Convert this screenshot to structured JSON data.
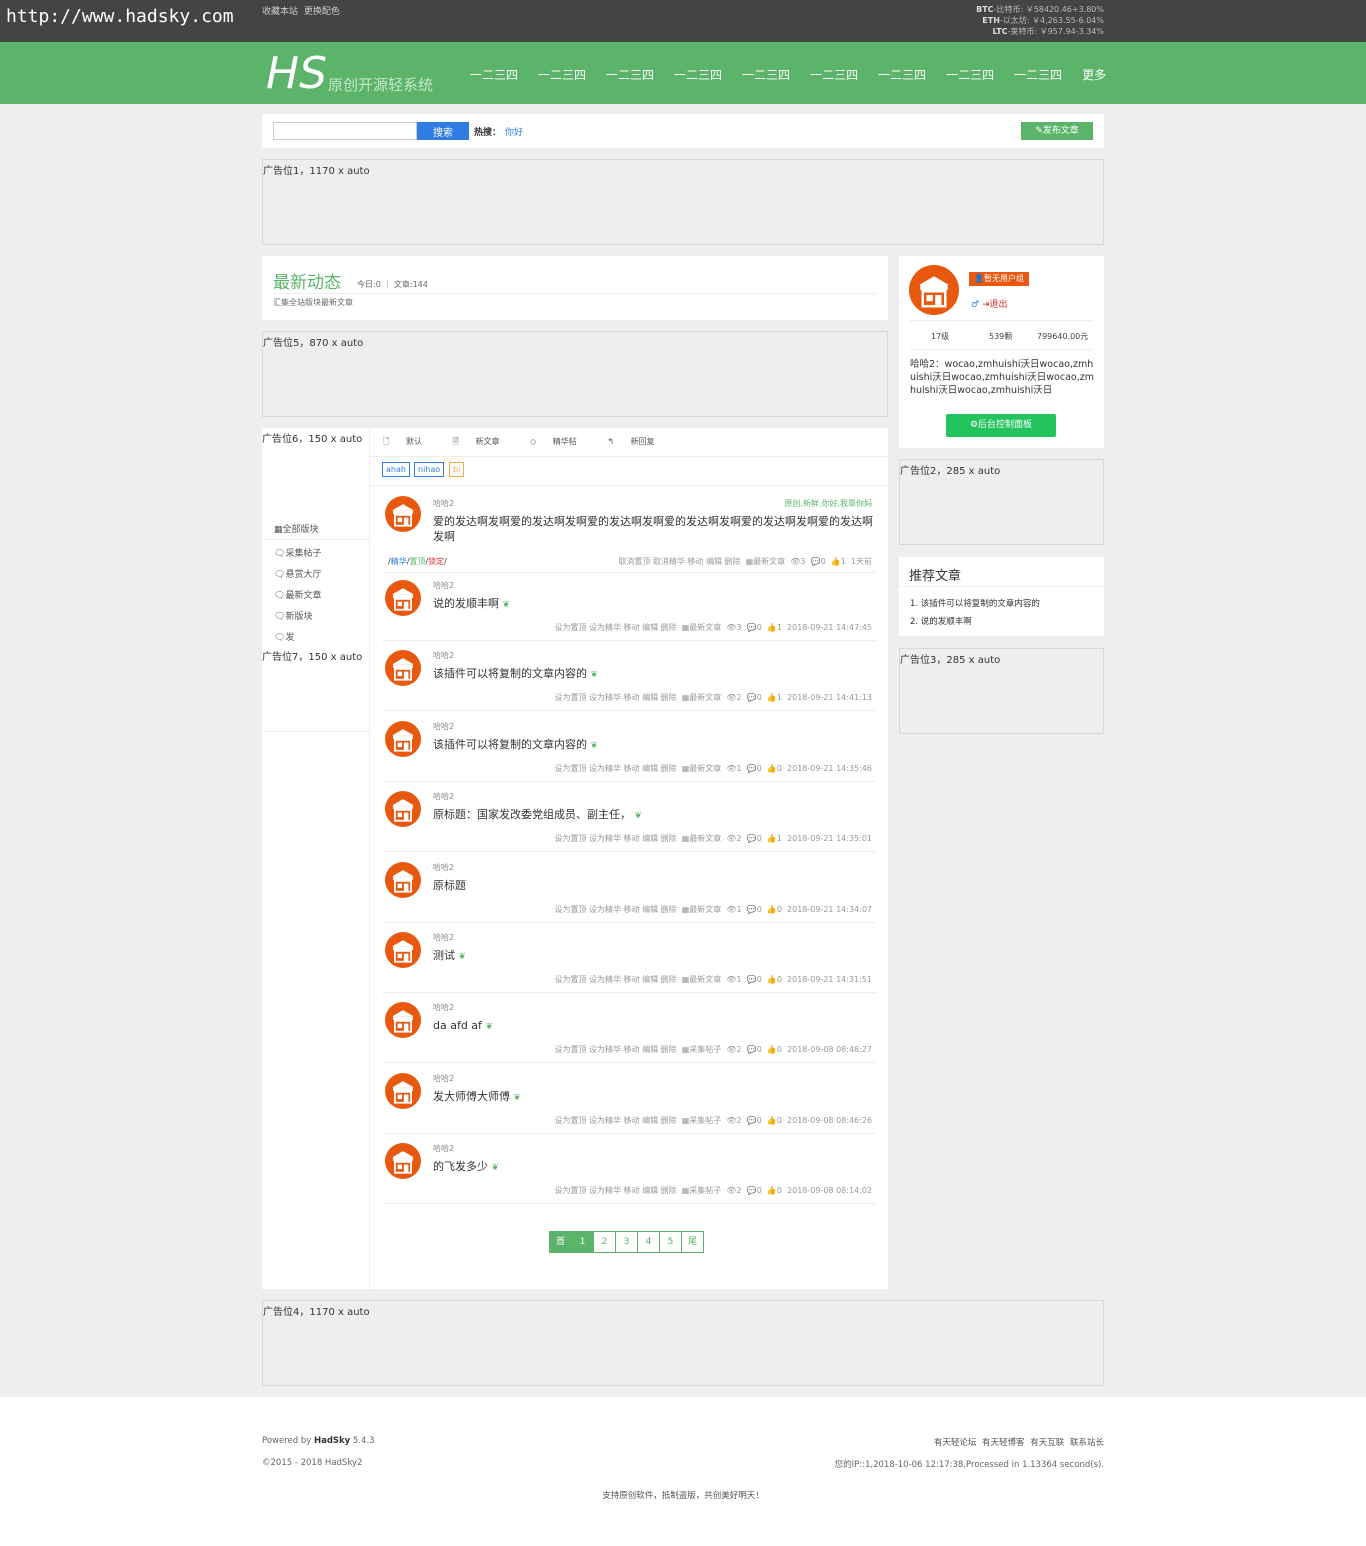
{
  "topbar": {
    "site_url": "http://www.hadsky.com",
    "links": [
      "收藏本站",
      "更换配色"
    ],
    "crypto": [
      {
        "code": "BTC",
        "name": "-比特币:",
        "value": "￥58420.46+3.80%"
      },
      {
        "code": "ETH",
        "name": "-以太坊:",
        "value": "￥4,263.55-6.04%"
      },
      {
        "code": "LTC",
        "name": "-莱特币:",
        "value": "￥957.94-3.34%"
      }
    ]
  },
  "header": {
    "logo": "HS",
    "logo_sub": "原创开源轻系统",
    "nav": [
      "一二三四",
      "一二三四",
      "一二三四",
      "一二三四",
      "一二三四",
      "一二三四",
      "一二三四",
      "一二三四",
      "一二三四",
      "更多"
    ],
    "accent": "#5bb46a"
  },
  "search": {
    "button": "搜索",
    "hot_label": "热搜：",
    "hot_link": "你好",
    "publish": "发布文章"
  },
  "ads": {
    "ad1": "广告位1，1170 x auto",
    "ad5": "广告位5，870 x auto",
    "ad6": "广告位6，150 x auto",
    "ad7": "广告位7，150 x auto",
    "ad2": "广告位2，285 x auto",
    "ad3": "广告位3，285 x auto",
    "ad4": "广告位4，1170 x auto"
  },
  "latest": {
    "title": "最新动态",
    "stats": "今日:0 ｜ 文章:144",
    "desc": "汇集全站版块最新文章"
  },
  "categories": {
    "all": "全部版块",
    "items": [
      "采集帖子",
      "悬赏大厅",
      "最新文章",
      "新版块",
      "发"
    ]
  },
  "feed": {
    "tabs": [
      "默认",
      "新文章",
      "精华帖",
      "新回复"
    ],
    "tags": [
      "ahah",
      "nihao",
      "bi"
    ],
    "first_post_tags": "原创,新鲜,你好,我靠你妈",
    "first_post_flags": {
      "a": "精华",
      "b": "置顶",
      "c": "锁定"
    },
    "posts": [
      {
        "author": "哈哈2",
        "title": "爱的发达啊发啊爱的发达啊发啊爱的发达啊发啊爱的发达啊发啊爱的发达啊发啊爱的发达啊发啊",
        "leaf": "",
        "actions": "取消置顶 取消精华 移动 编辑 删除",
        "board": "最新文章",
        "views": "3",
        "comments": "0",
        "likes": "1",
        "time": "1天前"
      },
      {
        "author": "哈哈2",
        "title": "说的发顺丰啊",
        "leaf": "❦",
        "actions": "设为置顶 设为精华 移动 编辑 删除",
        "board": "最新文章",
        "views": "3",
        "comments": "0",
        "likes": "1",
        "time": "2018-09-21 14:47:45"
      },
      {
        "author": "哈哈2",
        "title": "该插件可以将复制的文章内容的",
        "leaf": "❦",
        "actions": "设为置顶 设为精华 移动 编辑 删除",
        "board": "最新文章",
        "views": "2",
        "comments": "0",
        "likes": "1",
        "time": "2018-09-21 14:41:13"
      },
      {
        "author": "哈哈2",
        "title": "该插件可以将复制的文章内容的",
        "leaf": "❦",
        "actions": "设为置顶 设为精华 移动 编辑 删除",
        "board": "最新文章",
        "views": "1",
        "comments": "0",
        "likes": "0",
        "time": "2018-09-21 14:35:46"
      },
      {
        "author": "哈哈2",
        "title": "原标题：国家发改委党组成员、副主任，",
        "leaf": "❦",
        "actions": "设为置顶 设为精华 移动 编辑 删除",
        "board": "最新文章",
        "views": "2",
        "comments": "0",
        "likes": "1",
        "time": "2018-09-21 14:35:01"
      },
      {
        "author": "哈哈2",
        "title": "原标题",
        "leaf": "",
        "actions": "设为置顶 设为精华 移动 编辑 删除",
        "board": "最新文章",
        "views": "1",
        "comments": "0",
        "likes": "0",
        "time": "2018-09-21 14:34:07"
      },
      {
        "author": "哈哈2",
        "title": "测试",
        "leaf": "❦",
        "actions": "设为置顶 设为精华 移动 编辑 删除",
        "board": "最新文章",
        "views": "1",
        "comments": "0",
        "likes": "0",
        "time": "2018-09-21 14:31:51"
      },
      {
        "author": "哈哈2",
        "title": "da afd af",
        "leaf": "❦",
        "actions": "设为置顶 设为精华 移动 编辑 删除",
        "board": "采集帖子",
        "views": "2",
        "comments": "0",
        "likes": "0",
        "time": "2018-09-08 08:48:27"
      },
      {
        "author": "哈哈2",
        "title": "发大师傅大师傅",
        "leaf": "❦",
        "actions": "设为置顶 设为精华 移动 编辑 删除",
        "board": "采集帖子",
        "views": "2",
        "comments": "0",
        "likes": "0",
        "time": "2018-09-08 08:46:26"
      },
      {
        "author": "哈哈2",
        "title": "的飞发多少",
        "leaf": "❦",
        "actions": "设为置顶 设为精华 移动 编辑 删除",
        "board": "采集帖子",
        "views": "2",
        "comments": "0",
        "likes": "0",
        "time": "2018-09-08 08:14:02"
      }
    ]
  },
  "pagination": [
    "首",
    "1",
    "2",
    "3",
    "4",
    "5",
    "尾"
  ],
  "user": {
    "group": "暂无用户组",
    "logout": "退出",
    "level": "17级",
    "points": "539颗",
    "money": "799640.00元",
    "bio": "哈哈2：wocao,zmhuishi沃日wocao,zmhuishi沃日wocao,zmhuishi沃日wocao,zmhuishi沃日wocao,zmhuishi沃日",
    "admin_button": "后台控制面板"
  },
  "recommend": {
    "title": "推荐文章",
    "items": [
      "1. 该插件可以将复制的文章内容的",
      "2. 说的发顺丰啊"
    ]
  },
  "footer": {
    "powered_prefix": "Powered by ",
    "powered_name": "HadSky",
    "powered_version": " 5.4.3",
    "copyright": "©2015 - 2018 HadSky2",
    "links": [
      "有天轻论坛",
      "有天轻博客",
      "有天互联",
      "联系站长"
    ],
    "info": "您的IP::1,2018-10-06 12:17:38,Processed in 1.13364 second(s).",
    "slogan": "支持原创软件，抵制盗版，共创美好明天！"
  }
}
